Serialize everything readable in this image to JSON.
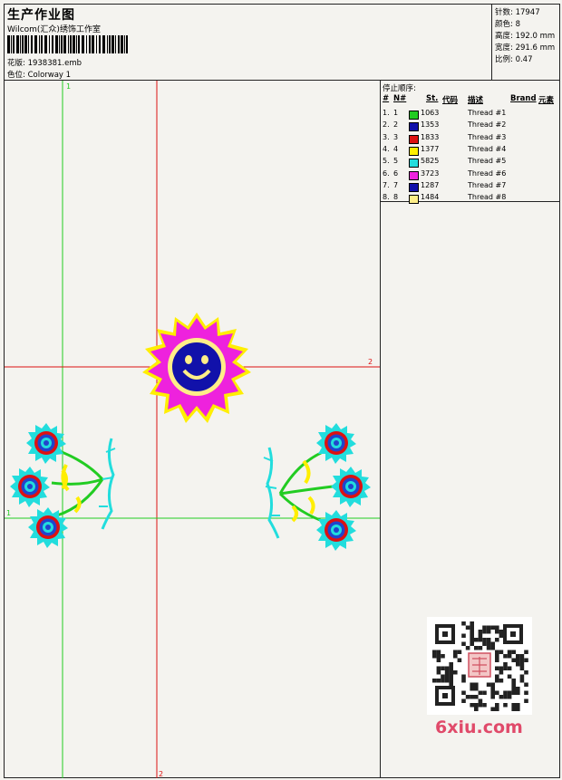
{
  "header": {
    "title": "生产作业图",
    "studio": "Wilcom(汇众)绣饰工作室",
    "design_file": "花版: 1938381.emb",
    "colorway": "色位: Colorway 1"
  },
  "stats": {
    "stitches": "针数: 17947",
    "colors": "颜色: 8",
    "height": "高度: 192.0 mm",
    "width": "宽度: 291.6 mm",
    "scale": "比例: 0.47"
  },
  "stop_sequence": {
    "title": "停止顺序:",
    "headers": {
      "index": "#",
      "needle": "N#",
      "st": "St.",
      "code": "代码",
      "desc": "描述",
      "brand": "Brand",
      "element": "元素"
    },
    "rows": [
      {
        "index": "1.",
        "needle": "1",
        "color": "#22cc22",
        "code": "1063",
        "desc": "Thread #1"
      },
      {
        "index": "2.",
        "needle": "2",
        "color": "#1111aa",
        "code": "1353",
        "desc": "Thread #2"
      },
      {
        "index": "3.",
        "needle": "3",
        "color": "#dd1111",
        "code": "1833",
        "desc": "Thread #3"
      },
      {
        "index": "4.",
        "needle": "4",
        "color": "#ffee00",
        "code": "1377",
        "desc": "Thread #4"
      },
      {
        "index": "5.",
        "needle": "5",
        "color": "#22dddd",
        "code": "5825",
        "desc": "Thread #5"
      },
      {
        "index": "6.",
        "needle": "6",
        "color": "#ee22dd",
        "code": "3723",
        "desc": "Thread #6"
      },
      {
        "index": "7.",
        "needle": "7",
        "color": "#1111aa",
        "code": "1287",
        "desc": "Thread #7"
      },
      {
        "index": "8.",
        "needle": "8",
        "color": "#ffee88",
        "code": "1484",
        "desc": "Thread #8"
      }
    ]
  },
  "guides": {
    "v1_label": "1",
    "v2_label": "2",
    "h1_label": "1",
    "h2_label": "2",
    "vertical_color": "#22cc22",
    "horizontal_color": "#dd1111"
  },
  "watermark": {
    "logo": "6xiu.com"
  }
}
